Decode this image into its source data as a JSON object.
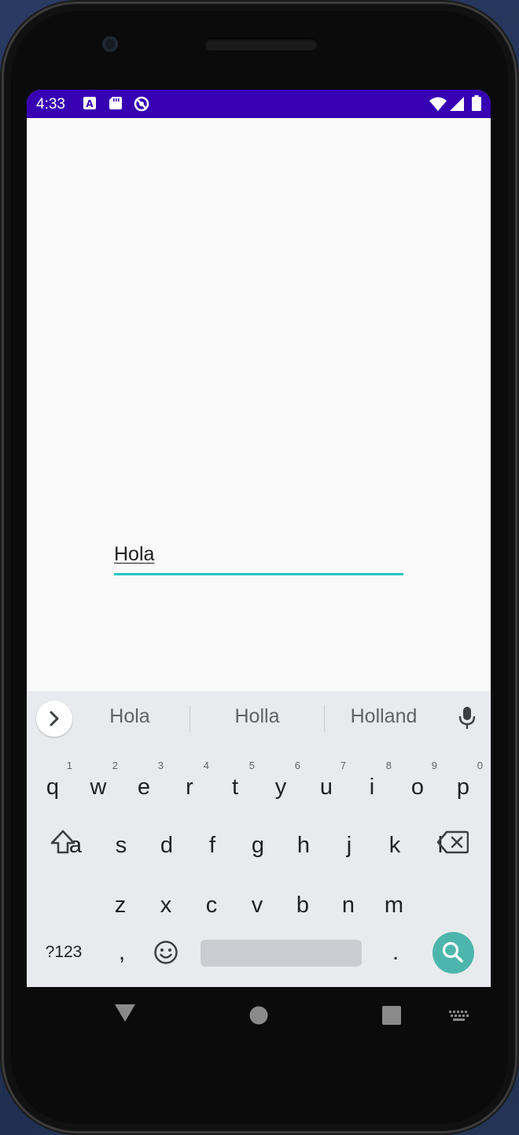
{
  "status_bar": {
    "time": "4:33",
    "left_icons": [
      "text-a-icon",
      "sd-card-icon",
      "do-not-disturb-icon"
    ],
    "right_icons": [
      "wifi-icon",
      "cellular-signal-icon",
      "battery-icon"
    ],
    "color": "#3700b3"
  },
  "text_field": {
    "value": "Hola",
    "underline_color": "#26c6c0"
  },
  "keyboard": {
    "suggestions": [
      "Hola",
      "Holla",
      "Holland"
    ],
    "row1": [
      {
        "key": "q",
        "hint": "1"
      },
      {
        "key": "w",
        "hint": "2"
      },
      {
        "key": "e",
        "hint": "3"
      },
      {
        "key": "r",
        "hint": "4"
      },
      {
        "key": "t",
        "hint": "5"
      },
      {
        "key": "y",
        "hint": "6"
      },
      {
        "key": "u",
        "hint": "7"
      },
      {
        "key": "i",
        "hint": "8"
      },
      {
        "key": "o",
        "hint": "9"
      },
      {
        "key": "p",
        "hint": "0"
      }
    ],
    "row2": [
      "a",
      "s",
      "d",
      "f",
      "g",
      "h",
      "j",
      "k",
      "l"
    ],
    "row3": [
      "z",
      "x",
      "c",
      "v",
      "b",
      "n",
      "m"
    ],
    "symbols_key": "?123",
    "comma_key": ",",
    "period_key": ".",
    "search_key_color": "#4db6ac"
  },
  "nav_bar": {
    "icons": [
      "back-icon",
      "home-icon",
      "recents-icon",
      "keyboard-switch-icon"
    ]
  }
}
